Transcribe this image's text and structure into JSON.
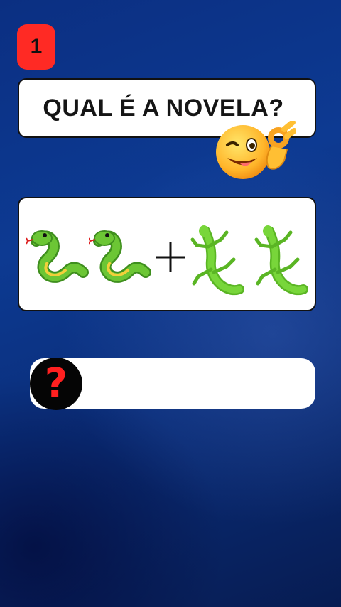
{
  "quiz": {
    "number": "1",
    "question": "QUAL É A NOVELA?",
    "answer_placeholder": "?",
    "clue_emojis": [
      "snake-icon",
      "snake-icon",
      "plus-icon",
      "lizard-icon",
      "lizard-icon"
    ]
  },
  "colors": {
    "background": "#0d3a92",
    "badge": "#ff2a24",
    "question_mark": "#ff2020",
    "snake": "#5cb82e",
    "lizard": "#6ccc2a"
  }
}
